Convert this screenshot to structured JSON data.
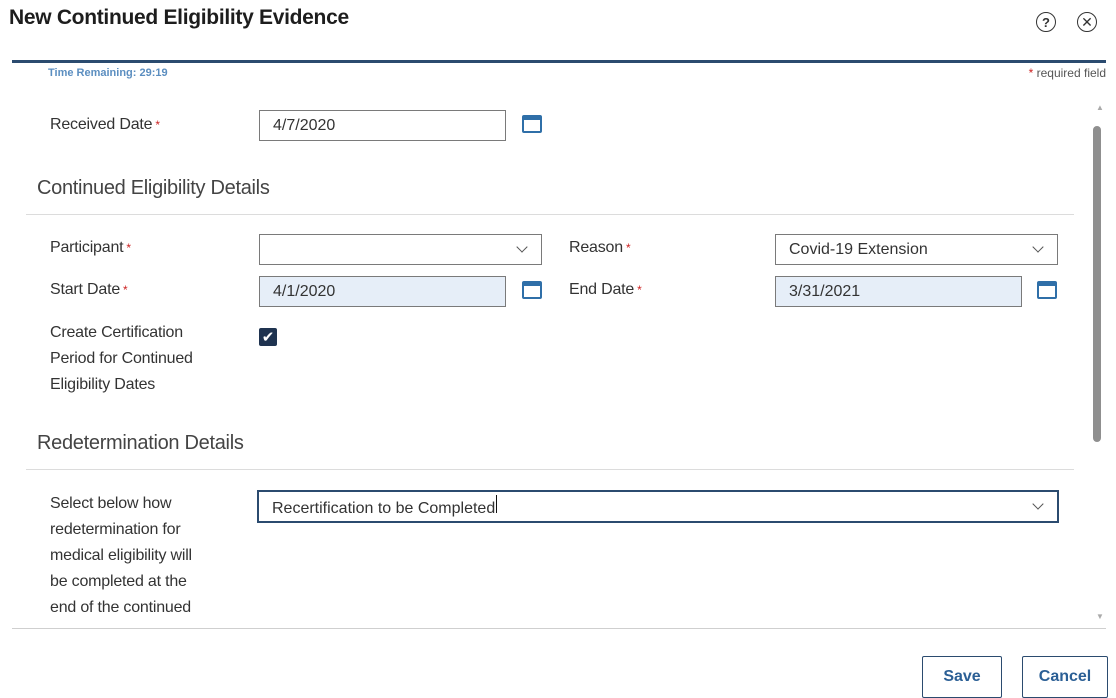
{
  "dialog": {
    "title": "New Continued Eligibility Evidence",
    "help_icon": "help-circle-icon",
    "close_icon": "close-circle-icon",
    "help_glyph": "?",
    "close_glyph": "✕"
  },
  "time_remaining": "Time Remaining: 29:19",
  "required_note": {
    "star": "*",
    "text": "required field"
  },
  "received_date": {
    "label": "Received Date",
    "required": "*",
    "value": "4/7/2020",
    "icon": "calendar-icon"
  },
  "sections": {
    "continued": "Continued Eligibility Details",
    "redetermination": "Redetermination Details"
  },
  "participant": {
    "label": "Participant",
    "required": "*",
    "value": ""
  },
  "reason": {
    "label": "Reason",
    "required": "*",
    "value": "Covid-19 Extension"
  },
  "start_date": {
    "label": "Start Date",
    "required": "*",
    "value": "4/1/2020",
    "icon": "calendar-icon"
  },
  "end_date": {
    "label": "End Date",
    "required": "*",
    "value": "3/31/2021",
    "icon": "calendar-icon"
  },
  "create_cert": {
    "label_lines": [
      "Create Certification",
      "Period for Continued",
      "Eligibility Dates"
    ],
    "checked": true,
    "check_glyph": "✔"
  },
  "redetermination": {
    "label_lines": [
      "Select below how",
      "redetermination for",
      "medical eligibility will",
      "be completed at the",
      "end of the continued"
    ],
    "value": "Recertification to be Completed"
  },
  "scroll": {
    "up_glyph": "▲",
    "down_glyph": "▼"
  },
  "buttons": {
    "save": "Save",
    "cancel": "Cancel"
  },
  "colors": {
    "accent": "#2b4b6f",
    "required": "#cc2222",
    "filled_field": "#e6eef8",
    "calendar": "#2f6fa8"
  }
}
